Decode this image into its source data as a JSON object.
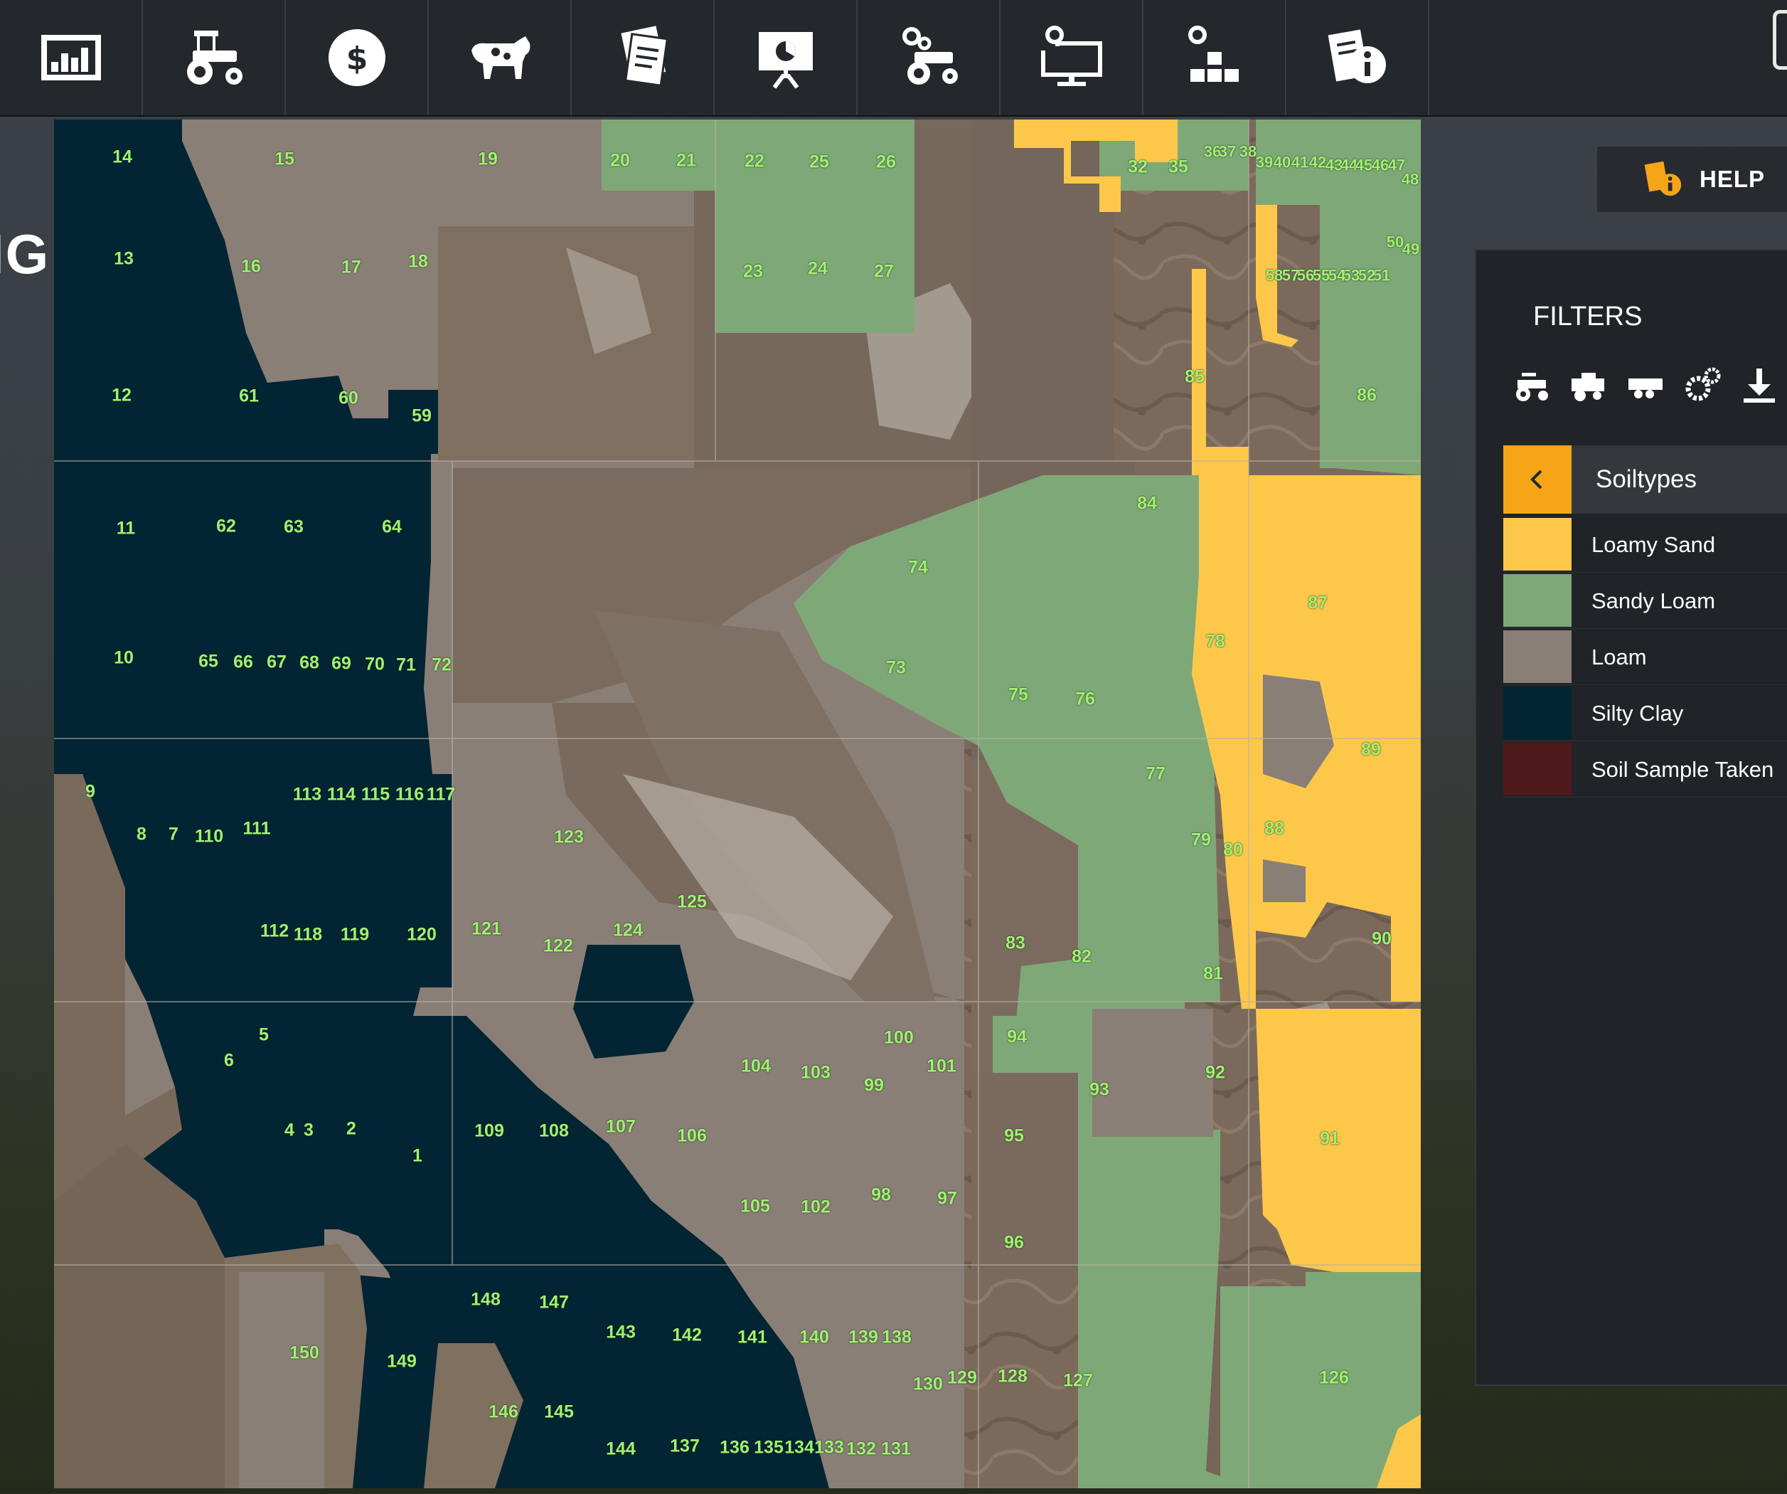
{
  "toolbar": {
    "icons": [
      "stats-icon",
      "tractor-icon",
      "dollar-icon",
      "cow-icon",
      "contracts-icon",
      "presentation-icon",
      "vehicle-settings-icon",
      "computer-settings-icon",
      "production-icon",
      "info-icon"
    ]
  },
  "page_title_fragment": "IG",
  "help": {
    "label": "HELP"
  },
  "filters": {
    "title": "FILTERS",
    "icons": [
      "tractor-filter-icon",
      "harvester-filter-icon",
      "trailer-filter-icon",
      "gears-filter-icon",
      "download-filter-icon"
    ],
    "category": "Soiltypes"
  },
  "legend": [
    {
      "label": "Loamy Sand",
      "color": "#fdc84a"
    },
    {
      "label": "Sandy Loam",
      "color": "#7fa878"
    },
    {
      "label": "Loam",
      "color": "#8a7f76"
    },
    {
      "label": "Silty Clay",
      "color": "#022433"
    },
    {
      "label": "Soil Sample Taken",
      "color": "#4f181b"
    }
  ],
  "field_numbers": [
    "1",
    "2",
    "3",
    "4",
    "5",
    "6",
    "7",
    "8",
    "9",
    "10",
    "11",
    "12",
    "13",
    "14",
    "15",
    "16",
    "17",
    "18",
    "19",
    "20",
    "21",
    "22",
    "23",
    "24",
    "25",
    "26",
    "27",
    "32",
    "35",
    "36",
    "37",
    "38",
    "39",
    "40",
    "41",
    "42",
    "43",
    "44",
    "45",
    "46",
    "47",
    "48",
    "49",
    "50",
    "51",
    "52",
    "53",
    "54",
    "55",
    "56",
    "57",
    "58",
    "59",
    "60",
    "61",
    "62",
    "63",
    "64",
    "65",
    "66",
    "67",
    "68",
    "69",
    "70",
    "71",
    "72",
    "73",
    "74",
    "75",
    "76",
    "77",
    "78",
    "79",
    "80",
    "81",
    "82",
    "83",
    "84",
    "85",
    "86",
    "87",
    "88",
    "89",
    "90",
    "91",
    "92",
    "93",
    "94",
    "95",
    "96",
    "97",
    "98",
    "99",
    "100",
    "101",
    "102",
    "103",
    "104",
    "105",
    "106",
    "107",
    "108",
    "109",
    "110",
    "111",
    "112",
    "113",
    "114",
    "115",
    "116",
    "117",
    "118",
    "119",
    "120",
    "121",
    "122",
    "123",
    "124",
    "125",
    "126",
    "127",
    "128",
    "129",
    "130",
    "131",
    "132",
    "133",
    "134",
    "135",
    "136",
    "137",
    "138",
    "139",
    "140",
    "141",
    "142",
    "143",
    "144",
    "145",
    "146",
    "147",
    "148",
    "149",
    "150"
  ]
}
